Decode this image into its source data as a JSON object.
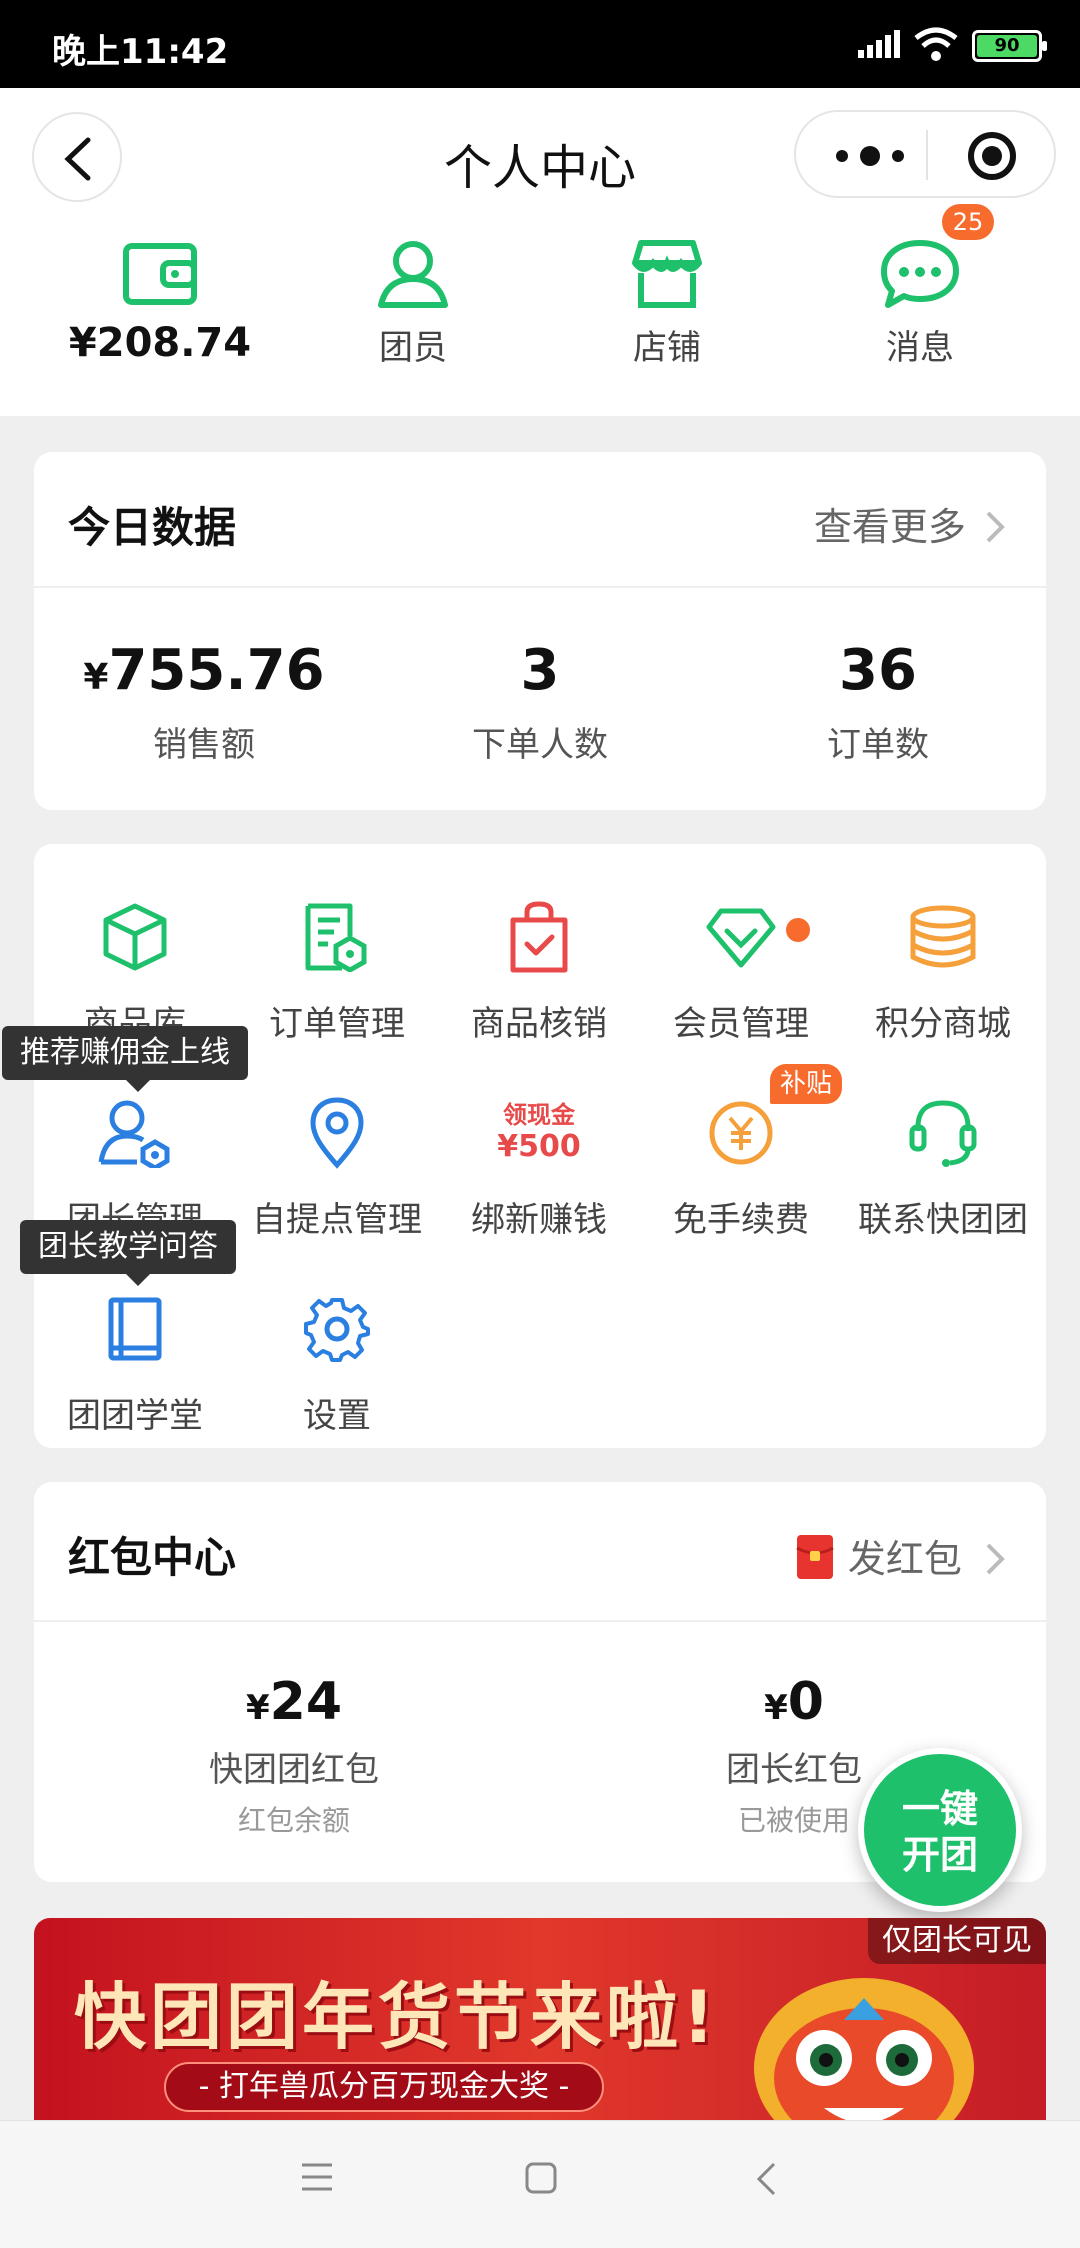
{
  "status": {
    "time": "晚上11:42",
    "battery": "90"
  },
  "nav": {
    "title": "个人中心"
  },
  "quick": {
    "wallet_amount": "¥208.74",
    "members": "团员",
    "store": "店铺",
    "messages": "消息",
    "messages_badge": "25"
  },
  "today": {
    "title": "今日数据",
    "more": "查看更多",
    "sales_currency": "¥",
    "sales_value": "755.76",
    "sales_label": "销售额",
    "buyers_value": "3",
    "buyers_label": "下单人数",
    "orders_value": "36",
    "orders_label": "订单数"
  },
  "grid": {
    "items": [
      {
        "label": "商品库"
      },
      {
        "label": "订单管理"
      },
      {
        "label": "商品核销"
      },
      {
        "label": "会员管理"
      },
      {
        "label": "积分商城"
      },
      {
        "label": "团长管理"
      },
      {
        "label": "自提点管理"
      },
      {
        "label": "绑新赚钱"
      },
      {
        "label": "免手续费"
      },
      {
        "label": "联系快团团"
      },
      {
        "label": "团团学堂"
      },
      {
        "label": "设置"
      }
    ],
    "newbind_top": "领现金",
    "newbind_amount": "¥500",
    "subsidy_badge": "补贴",
    "tip_leader": "推荐赚佣金上线",
    "tip_school": "团长教学问答"
  },
  "redpacket": {
    "title": "红包中心",
    "send": "发红包",
    "left_currency": "¥",
    "left_value": "24",
    "left_label": "快团团红包",
    "left_sub": "红包余额",
    "right_currency": "¥",
    "right_value": "0",
    "right_label": "团长红包",
    "right_sub": "已被使用"
  },
  "fab": {
    "line1": "一键",
    "line2": "开团"
  },
  "banner": {
    "headline": "快团团年货节来啦!",
    "sub": "- 打年兽瓜分百万现金大奖 -",
    "visibility": "仅团长可见"
  },
  "colors": {
    "brand_green": "#1ec06b",
    "accent_orange": "#f76b2d",
    "red": "#e84a4a",
    "blue": "#2b7fe0"
  }
}
